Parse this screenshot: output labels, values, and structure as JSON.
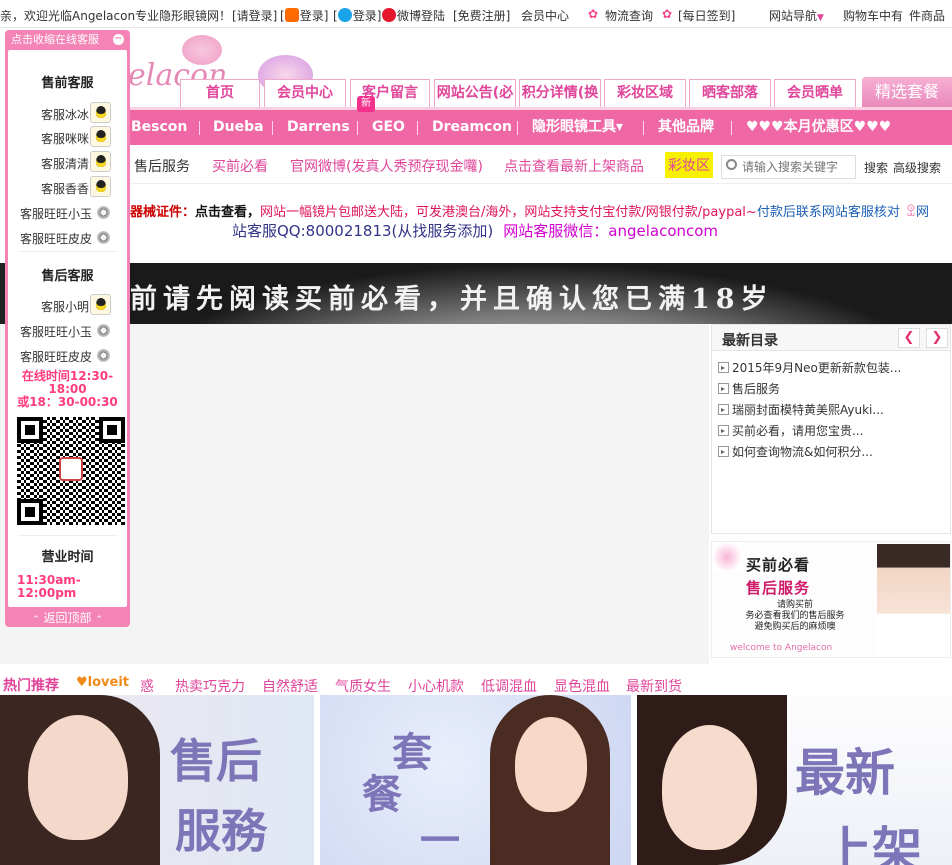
{
  "topbar": {
    "welcome": "亲，欢迎光临Angelacon专业隐形眼镜网！",
    "login_prompt": "[请登录]",
    "taobao_login": "登录",
    "qq_login": "登录",
    "weibo_login": "微博登陆",
    "register": "[免费注册]",
    "member_center": "会员中心",
    "logistics": "物流查询",
    "daily_checkin": "[每日签到]",
    "site_nav": "网站导航",
    "cart": "购物车中有",
    "cart_suffix": "件商品"
  },
  "logo": {
    "text": "elacon"
  },
  "main_tabs": [
    "首页",
    "会员中心",
    "客户留言",
    "网站公告(必",
    "积分详情(换",
    "彩妆区域",
    "晒客部落",
    "会员晒单"
  ],
  "special_tab": "精选套餐",
  "new_badge": "新",
  "brand_nav": [
    "Bescon",
    "Dueba",
    "Darrens",
    "GEO",
    "Dreamcon",
    "隐形眼镜工具▾",
    "其他品牌",
    "♥♥♥本月优惠区♥♥♥"
  ],
  "sub_nav": {
    "after_sales": "售后服务",
    "must_read": "买前必看",
    "weibo": "官网微博(发真人秀预存现金囖)",
    "newest": "点击查看最新上架商品",
    "makeup": "彩妆区",
    "search_placeholder": "请输入搜索关键字",
    "search_btn": "搜索",
    "advanced": "高级搜索"
  },
  "notice": {
    "cert": "器械证件：",
    "click": "点击查看，",
    "line1": "网站一幅镜片包邮送大陆，可发港澳台/海外，网站支持支付宝付款/网银付款/paypal~",
    "line1b": "付款后联系网站客服核对",
    "tail": "网",
    "qq": "站客服QQ:800021813(从找服务添加)",
    "wechat": "网站客服微信：angelaconcom"
  },
  "banner_text": "前请先阅读买前必看，并且确认您已满18岁",
  "catalog": {
    "title": "最新目录",
    "items": [
      "2015年9月Neo更新新款包装...",
      "售后服务",
      "瑞丽封面模特黄美熙Ayuki...",
      "买前必看，请用您宝贵...",
      "如何查询物流&如何积分..."
    ]
  },
  "promo": {
    "title": "买前必看",
    "subtitle": "售后服务",
    "line1": "请购买前",
    "line2": "务必查看我们的售后服务",
    "line3": "避免购买后的麻烦噢",
    "footer": "welcome to Angelacon"
  },
  "hot": {
    "title": "热门推荐",
    "items": [
      "热卖巧克力",
      "自然舒适",
      "气质女生",
      "小心机款",
      "低调混血",
      "显色混血",
      "最新到货"
    ],
    "lead": "惑"
  },
  "pics": {
    "p1": [
      "售后",
      "服務"
    ],
    "p2": [
      "套",
      "餐",
      "一"
    ],
    "p3": [
      "最新",
      "上架"
    ]
  },
  "service": {
    "head": "点击收缩在线客服",
    "presale_title": "售前客服",
    "presale": [
      "客服冰冰",
      "客服咪咪",
      "客服清清",
      "客服香香"
    ],
    "presale_ww": [
      "客服旺旺小玉",
      "客服旺旺皮皮"
    ],
    "aftersale_title": "售后客服",
    "aftersale": [
      "客服小明"
    ],
    "aftersale_ww": [
      "客服旺旺小玉",
      "客服旺旺皮皮"
    ],
    "online_time": [
      "在线时间12:30-",
      "18:00",
      "或18：30-00:30"
    ],
    "hours_title": "营业时间",
    "hours": [
      "11:30am-",
      "12:00pm"
    ],
    "back_top": "返回顶部"
  },
  "colors": {
    "brand_pink": "#f067a6",
    "tab_text": "#e0459a",
    "service_pink": "#f484b5"
  }
}
